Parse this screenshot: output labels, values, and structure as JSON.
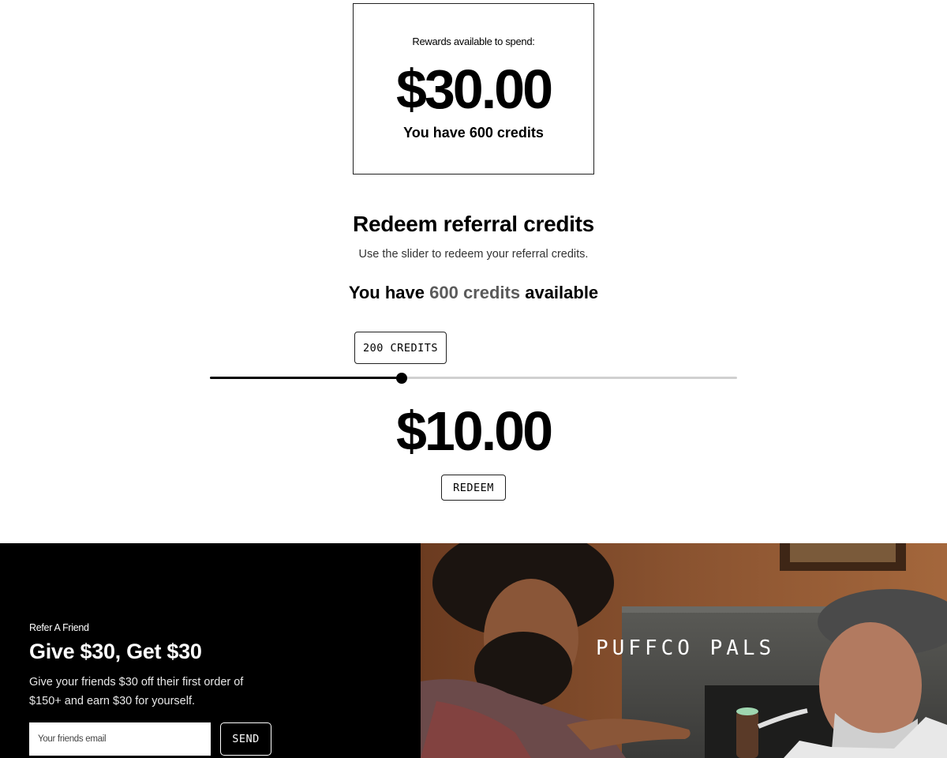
{
  "rewards": {
    "caption": "Rewards available to spend:",
    "amount": "$30.00",
    "credits_text": "You have 600 credits"
  },
  "redeem": {
    "title": "Redeem referral credits",
    "subtitle": "Use the slider to redeem your referral credits.",
    "available_prefix": "You have",
    "available_highlight": "600 credits",
    "available_suffix": "available",
    "slider_label": "200 CREDITS",
    "slider_value": 200,
    "slider_max": 550,
    "amount": "$10.00",
    "button_label": "REDEEM"
  },
  "refer": {
    "eyebrow": "Refer A Friend",
    "title": "Give $30, Get $30",
    "description": "Give your friends $30 off their first order of $150+ and earn $30 for yourself.",
    "email_placeholder": "Your friends email",
    "send_label": "SEND"
  },
  "promo": {
    "title": "PUFFCO PALS"
  },
  "colors": {
    "highlight_text": "#5b5b5b",
    "slider_fill": "#000000",
    "slider_track": "#d0d0d0",
    "refer_background": "#000000"
  }
}
